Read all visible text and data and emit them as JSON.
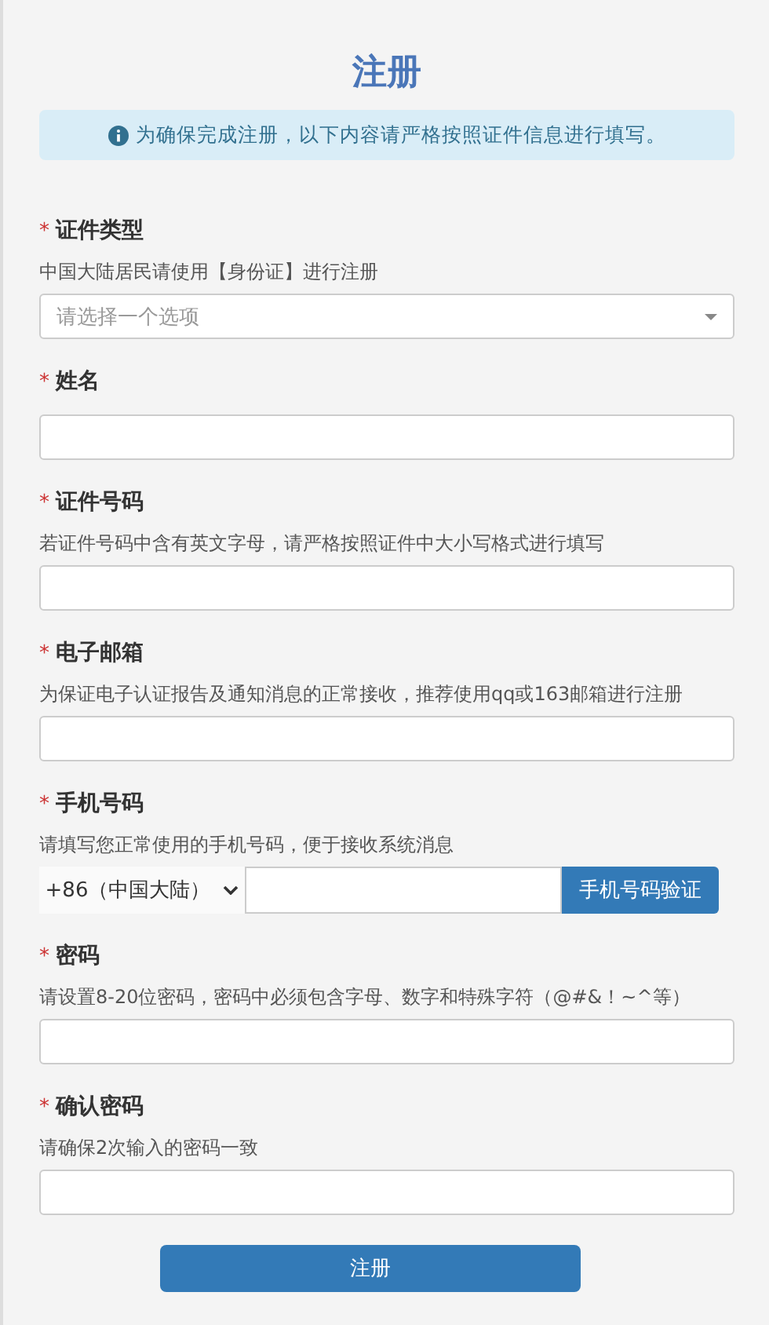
{
  "title": "注册",
  "notice": "为确保完成注册，以下内容请严格按照证件信息进行填写。",
  "fields": [
    {
      "kind": "select",
      "required_mark": "*",
      "label": "证件类型",
      "hint": "中国大陆居民请使用【身份证】进行注册",
      "placeholder": "请选择一个选项"
    },
    {
      "kind": "text",
      "required_mark": "*",
      "label": "姓名"
    },
    {
      "kind": "text",
      "required_mark": "*",
      "label": "证件号码",
      "hint": "若证件号码中含有英文字母，请严格按照证件中大小写格式进行填写"
    },
    {
      "kind": "text",
      "required_mark": "*",
      "label": "电子邮箱",
      "hint": "为保证电子认证报告及通知消息的正常接收，推荐使用qq或163邮箱进行注册"
    },
    {
      "kind": "phone",
      "required_mark": "*",
      "label": "手机号码",
      "hint": "请填写您正常使用的手机号码，便于接收系统消息",
      "country_code": "+86（中国大陆）",
      "button": "手机号码验证"
    },
    {
      "kind": "text",
      "required_mark": "*",
      "label": "密码",
      "hint": "请设置8-20位密码，密码中必须包含字母、数字和特殊字符（@#&！~^等）"
    },
    {
      "kind": "text",
      "required_mark": "*",
      "label": "确认密码",
      "hint": "请确保2次输入的密码一致"
    }
  ],
  "submit": "注册"
}
